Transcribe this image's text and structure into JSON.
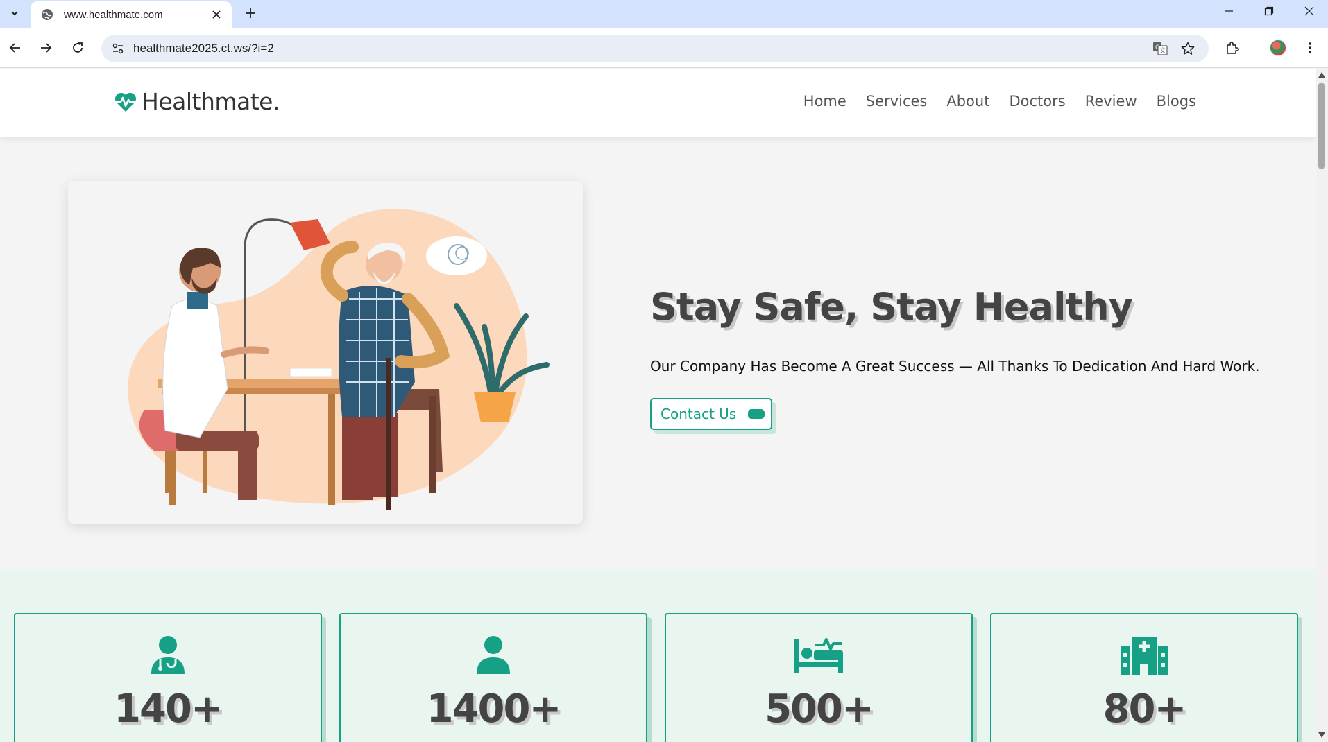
{
  "browser": {
    "tab_title": "www.healthmate.com",
    "url": "healthmate2025.ct.ws/?i=2",
    "icons": [
      "tab-search-icon",
      "globe-icon",
      "close-icon",
      "plus-icon",
      "minimize-icon",
      "restore-icon",
      "window-close-icon",
      "back-icon",
      "forward-icon",
      "reload-icon",
      "site-info-icon",
      "translate-icon",
      "star-icon",
      "extensions-icon",
      "profile-avatar",
      "kebab-menu-icon"
    ]
  },
  "site": {
    "logo_text": "Healthmate.",
    "nav": [
      "Home",
      "Services",
      "About",
      "Doctors",
      "Review",
      "Blogs"
    ],
    "accent_color": "#16a085"
  },
  "hero": {
    "title": "Stay Safe, Stay Healthy",
    "subtitle": "Our Company Has Become A Great Success — All Thanks To Dedication And Hard Work.",
    "button_label": "Contact Us"
  },
  "stats": [
    {
      "icon": "doctor-icon",
      "value": "140+"
    },
    {
      "icon": "patient-icon",
      "value": "1400+"
    },
    {
      "icon": "bed-icon",
      "value": "500+"
    },
    {
      "icon": "hospital-icon",
      "value": "80+"
    }
  ]
}
